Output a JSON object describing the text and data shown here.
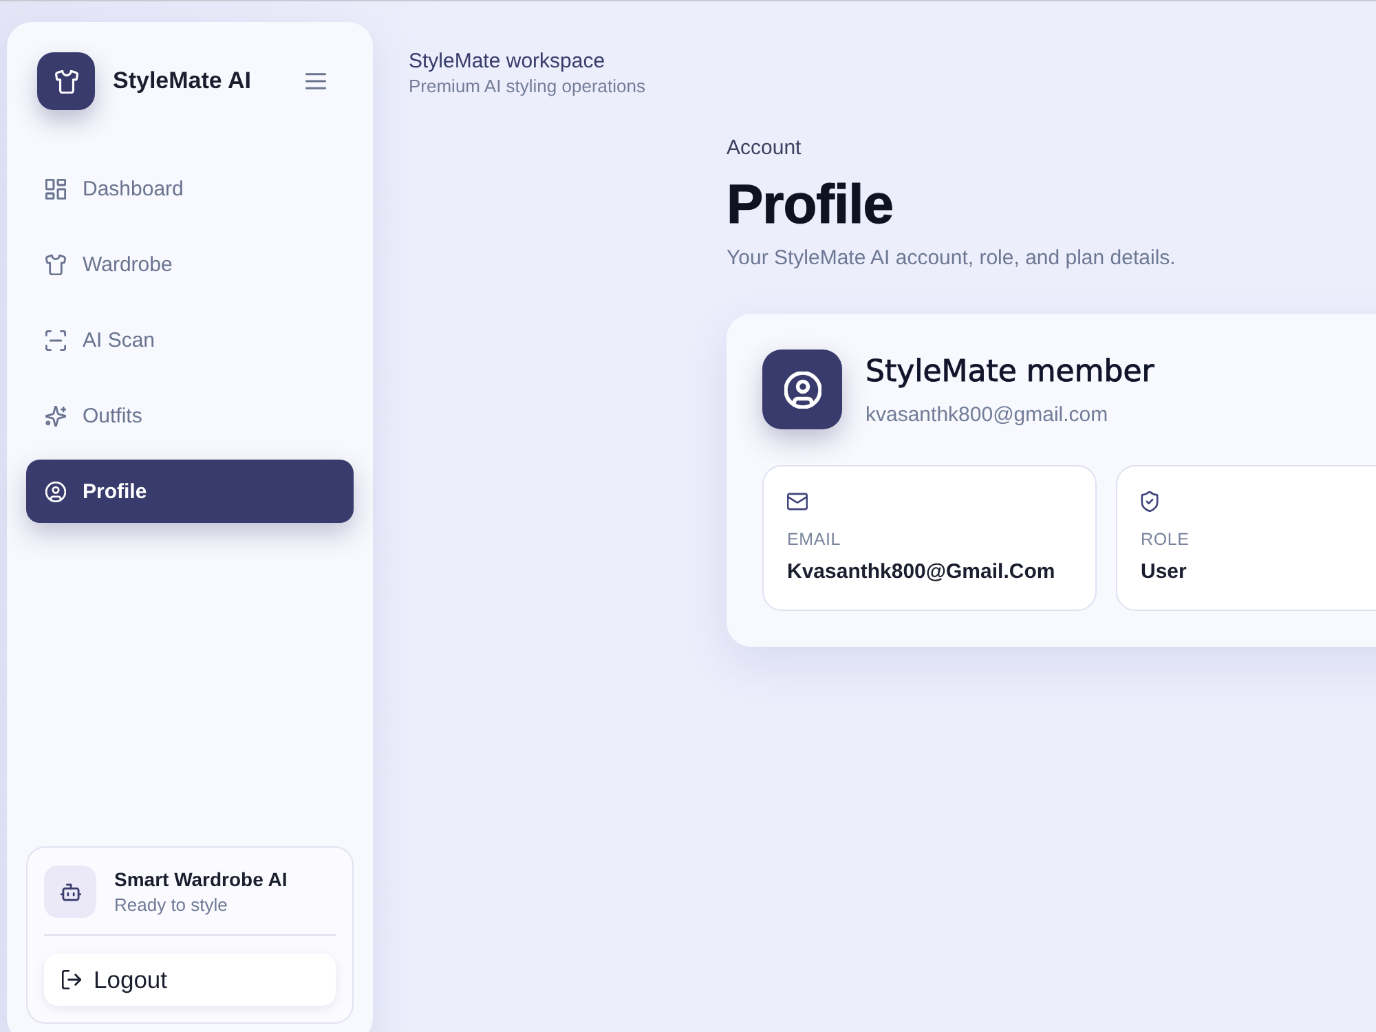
{
  "sidebar": {
    "brand": "StyleMate AI",
    "nav": [
      {
        "kind": "dashboard",
        "label": "Dashboard",
        "selected": false
      },
      {
        "kind": "wardrobe",
        "label": "Wardrobe",
        "selected": false
      },
      {
        "kind": "scan",
        "label": "AI Scan",
        "selected": false
      },
      {
        "kind": "outfits",
        "label": "Outfits",
        "selected": false
      },
      {
        "kind": "profile",
        "label": "Profile",
        "selected": true
      }
    ],
    "assistant": {
      "title": "Smart Wardrobe AI",
      "status": "Ready to style"
    },
    "logout": "Logout"
  },
  "header": {
    "title": "StyleMate workspace",
    "subtitle": "Premium AI styling operations"
  },
  "page": {
    "eyebrow": "Account",
    "title": "Profile",
    "description": "Your StyleMate AI account, role, and plan details."
  },
  "profile_card": {
    "name": "StyleMate member",
    "email": "kvasanthk800@gmail.com",
    "fields": [
      {
        "kind": "email",
        "label": "EMAIL",
        "value": "Kvasanthk800@Gmail.Com"
      },
      {
        "kind": "role",
        "label": "ROLE",
        "value": "User"
      }
    ]
  }
}
